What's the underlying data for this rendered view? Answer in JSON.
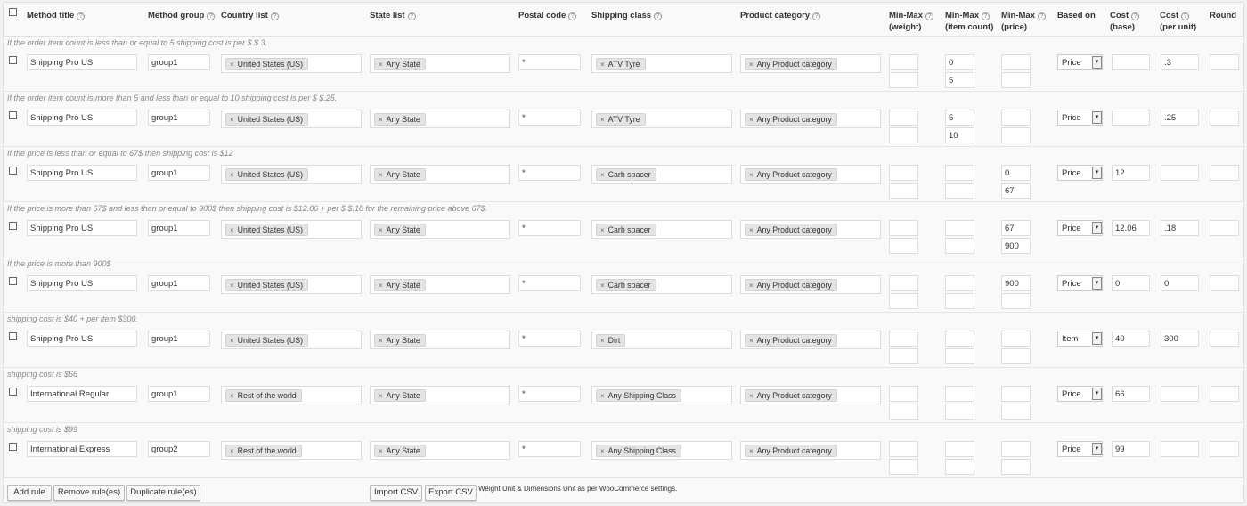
{
  "header": {
    "method_title": "Method title",
    "method_group": "Method group",
    "country_list": "Country list",
    "state_list": "State list",
    "postal_code": "Postal code",
    "shipping_class": "Shipping class",
    "product_category": "Product category",
    "minmax_weight_1": "Min-Max",
    "minmax_weight_2": "(weight)",
    "minmax_count_1": "Min-Max",
    "minmax_count_2": "(item count)",
    "minmax_price_1": "Min-Max",
    "minmax_price_2": "(price)",
    "based_on": "Based on",
    "cost_base_1": "Cost",
    "cost_base_2": "(base)",
    "cost_unit_1": "Cost",
    "cost_unit_2": "(per unit)",
    "round": "Round",
    "help_glyph": "?"
  },
  "rules": [
    {
      "note": "If the order item count is less than or equal to 5 shipping cost is per $ $.3.",
      "title": "Shipping Pro US",
      "group": "group1",
      "country": "United States (US)",
      "state": "Any State",
      "postal": "*",
      "ship_class": "ATV Tyre",
      "category": "Any Product category",
      "w_min": "",
      "w_max": "",
      "c_min": "0",
      "c_max": "5",
      "p_min": "",
      "p_max": "",
      "based_on": "Price",
      "cost_base": "",
      "cost_unit": ".3",
      "round": ""
    },
    {
      "note": "If the order item count is more than 5 and less than or equal to 10 shipping cost is per $ $.25.",
      "title": "Shipping Pro US",
      "group": "group1",
      "country": "United States (US)",
      "state": "Any State",
      "postal": "*",
      "ship_class": "ATV Tyre",
      "category": "Any Product category",
      "w_min": "",
      "w_max": "",
      "c_min": "5",
      "c_max": "10",
      "p_min": "",
      "p_max": "",
      "based_on": "Price",
      "cost_base": "",
      "cost_unit": ".25",
      "round": ""
    },
    {
      "note": "If the price is less than or equal to 67$ then shipping cost is $12",
      "title": "Shipping Pro US",
      "group": "group1",
      "country": "United States (US)",
      "state": "Any State",
      "postal": "*",
      "ship_class": "Carb spacer",
      "category": "Any Product category",
      "w_min": "",
      "w_max": "",
      "c_min": "",
      "c_max": "",
      "p_min": "0",
      "p_max": "67",
      "based_on": "Price",
      "cost_base": "12",
      "cost_unit": "",
      "round": ""
    },
    {
      "note": "If the price is more than 67$ and less than or equal to 900$ then shipping cost is $12.06 + per $ $.18 for the remaining price above 67$.",
      "title": "Shipping Pro US",
      "group": "group1",
      "country": "United States (US)",
      "state": "Any State",
      "postal": "*",
      "ship_class": "Carb spacer",
      "category": "Any Product category",
      "w_min": "",
      "w_max": "",
      "c_min": "",
      "c_max": "",
      "p_min": "67",
      "p_max": "900",
      "based_on": "Price",
      "cost_base": "12.06",
      "cost_unit": ".18",
      "round": ""
    },
    {
      "note": "If the price is more than 900$",
      "title": "Shipping Pro US",
      "group": "group1",
      "country": "United States (US)",
      "state": "Any State",
      "postal": "*",
      "ship_class": "Carb spacer",
      "category": "Any Product category",
      "w_min": "",
      "w_max": "",
      "c_min": "",
      "c_max": "",
      "p_min": "900",
      "p_max": "",
      "based_on": "Price",
      "cost_base": "0",
      "cost_unit": "0",
      "round": ""
    },
    {
      "note": "shipping cost is $40 + per item $300.",
      "title": "Shipping Pro US",
      "group": "group1",
      "country": "United States (US)",
      "state": "Any State",
      "postal": "*",
      "ship_class": "Dirt",
      "category": "Any Product category",
      "w_min": "",
      "w_max": "",
      "c_min": "",
      "c_max": "",
      "p_min": "",
      "p_max": "",
      "based_on": "Item",
      "cost_base": "40",
      "cost_unit": "300",
      "round": ""
    },
    {
      "note": "shipping cost is $66",
      "title": "International Regular",
      "group": "group1",
      "country": "Rest of the world",
      "state": "Any State",
      "postal": "*",
      "ship_class": "Any Shipping Class",
      "category": "Any Product category",
      "w_min": "",
      "w_max": "",
      "c_min": "",
      "c_max": "",
      "p_min": "",
      "p_max": "",
      "based_on": "Price",
      "cost_base": "66",
      "cost_unit": "",
      "round": ""
    },
    {
      "note": "shipping cost is $99",
      "title": "International Express",
      "group": "group2",
      "country": "Rest of the world",
      "state": "Any State",
      "postal": "*",
      "ship_class": "Any Shipping Class",
      "category": "Any Product category",
      "w_min": "",
      "w_max": "",
      "c_min": "",
      "c_max": "",
      "p_min": "",
      "p_max": "",
      "based_on": "Price",
      "cost_base": "99",
      "cost_unit": "",
      "round": ""
    }
  ],
  "footer": {
    "add_rule": "Add rule",
    "remove_rules": "Remove rule(es)",
    "duplicate_rules": "Duplicate rule(es)",
    "import_csv": "Import CSV",
    "export_csv": "Export CSV",
    "note": "Weight Unit & Dimensions Unit as per WooCommerce settings."
  },
  "glyphs": {
    "chip_remove": "×",
    "select_arrow": "▾"
  }
}
